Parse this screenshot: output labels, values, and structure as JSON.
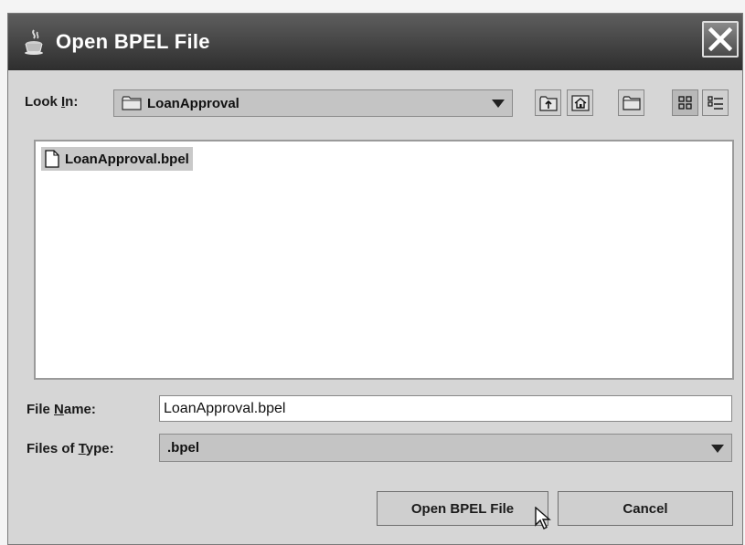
{
  "window": {
    "title": "Open BPEL File",
    "java_icon": "java-cup-icon",
    "close_icon": "close-icon"
  },
  "look_in": {
    "label_prefix": "Look ",
    "label_mnemonic": "I",
    "label_suffix": "n:",
    "selected": "LoanApproval",
    "folder_icon": "folder-icon"
  },
  "toolbar": {
    "buttons": [
      {
        "name": "up-one-level",
        "icon": "up-folder-icon"
      },
      {
        "name": "home",
        "icon": "home-icon"
      },
      {
        "name": "new-folder",
        "icon": "new-folder-icon"
      },
      {
        "name": "list-view",
        "icon": "list-view-icon"
      },
      {
        "name": "details-view",
        "icon": "details-view-icon"
      }
    ]
  },
  "files": [
    {
      "name": "LoanApproval.bpel",
      "icon": "file-icon",
      "selected": true
    }
  ],
  "file_name": {
    "label_prefix": "File ",
    "label_mnemonic": "N",
    "label_suffix": "ame:",
    "value": "LoanApproval.bpel"
  },
  "files_of_type": {
    "label_prefix": "Files of ",
    "label_mnemonic": "T",
    "label_suffix": "ype:",
    "selected": ".bpel"
  },
  "buttons": {
    "open": "Open BPEL File",
    "cancel": "Cancel"
  },
  "colors": {
    "titlebar": "#3c3c3c",
    "dialog_bg": "#d6d6d6",
    "selection": "#c9c9c9"
  }
}
